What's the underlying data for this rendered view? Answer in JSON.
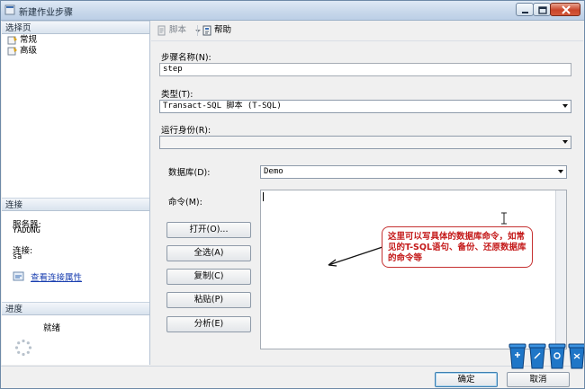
{
  "window": {
    "title": "新建作业步骤"
  },
  "left": {
    "select_page_header": "选择页",
    "pages": [
      {
        "label": "常规",
        "icon": "page-settings-icon"
      },
      {
        "label": "高级",
        "icon": "page-settings-icon"
      }
    ],
    "connection_header": "连接",
    "server_label": "服务器:",
    "server_value": "YADONG",
    "connection_label": "连接:",
    "connection_value": "sa",
    "view_connection_link": "查看连接属性",
    "progress_header": "进度",
    "progress_status": "就绪"
  },
  "toolbar": {
    "script_label": "脚本",
    "help_label": "帮助"
  },
  "form": {
    "step_name_label": "步骤名称(N):",
    "step_name_value": "step",
    "type_label": "类型(T):",
    "type_value": "Transact-SQL 脚本 (T-SQL)",
    "run_as_label": "运行身份(R):",
    "run_as_value": "",
    "database_label": "数据库(D):",
    "database_value": "Demo",
    "command_label": "命令(M):",
    "command_value": "",
    "buttons": {
      "open": "打开(O)...",
      "select_all": "全选(A)",
      "copy": "复制(C)",
      "paste": "粘贴(P)",
      "parse": "分析(E)"
    }
  },
  "annotation": {
    "text": "这里可以写具体的数据库命令，如常见的T-SQL语句、备份、还原数据库的命令等"
  },
  "footer": {
    "ok_label": "确定",
    "cancel_label": "取消"
  },
  "colors": {
    "accent": "#1a3fb0",
    "callout_red": "#c41a1a",
    "bin_blue": "#1f76c7"
  }
}
